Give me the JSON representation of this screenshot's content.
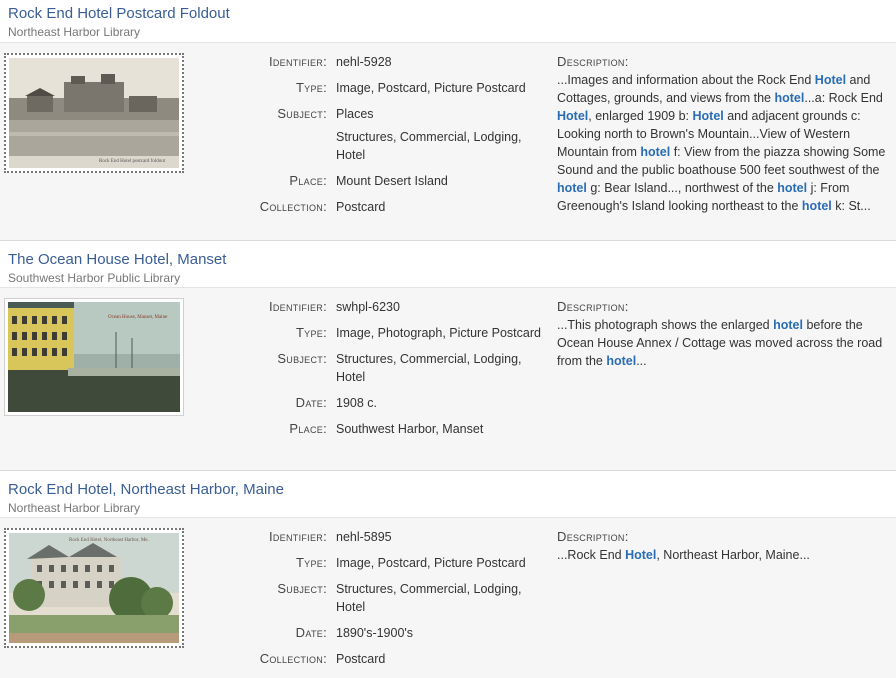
{
  "results": [
    {
      "title": "Rock End Hotel Postcard Foldout",
      "institution": "Northeast Harbor Library",
      "thumbnail_caption": "Rock End Hotel postcard foldout",
      "fields": [
        {
          "label": "Identifier:",
          "values": [
            "nehl-5928"
          ]
        },
        {
          "label": "Type:",
          "values": [
            "Image, Postcard, Picture Postcard"
          ]
        },
        {
          "label": "Subject:",
          "values": [
            "Places",
            "Structures, Commercial, Lodging, Hotel"
          ]
        },
        {
          "label": "Place:",
          "values": [
            "Mount Desert Island"
          ]
        },
        {
          "label": "Collection:",
          "values": [
            "Postcard"
          ]
        }
      ],
      "description_label": "Description:",
      "description": [
        {
          "t": "...Images and information about the Rock End ",
          "hl": false
        },
        {
          "t": "Hotel",
          "hl": true
        },
        {
          "t": " and Cottages, grounds, and views from the ",
          "hl": false
        },
        {
          "t": "hotel",
          "hl": true
        },
        {
          "t": "...a: Rock End ",
          "hl": false
        },
        {
          "t": "Hotel",
          "hl": true
        },
        {
          "t": ", enlarged 1909 b: ",
          "hl": false
        },
        {
          "t": "Hotel",
          "hl": true
        },
        {
          "t": " and adjacent grounds c: Looking north to Brown's Mountain...View of Western Mountain from ",
          "hl": false
        },
        {
          "t": "hotel",
          "hl": true
        },
        {
          "t": " f: View from the piazza showing Some Sound and the public boathouse 500 feet southwest of the ",
          "hl": false
        },
        {
          "t": "hotel",
          "hl": true
        },
        {
          "t": " g: Bear Island..., northwest of the ",
          "hl": false
        },
        {
          "t": "hotel",
          "hl": true
        },
        {
          "t": " j: From Greenough's Island looking northeast to the ",
          "hl": false
        },
        {
          "t": "hotel",
          "hl": true
        },
        {
          "t": " k: St...",
          "hl": false
        }
      ]
    },
    {
      "title": "The Ocean House Hotel, Manset",
      "institution": "Southwest Harbor Public Library",
      "thumbnail_caption": "Ocean House, Manset, Maine",
      "fields": [
        {
          "label": "Identifier:",
          "values": [
            "swhpl-6230"
          ]
        },
        {
          "label": "Type:",
          "values": [
            "Image, Photograph, Picture Postcard"
          ]
        },
        {
          "label": "Subject:",
          "values": [
            "Structures, Commercial, Lodging, Hotel"
          ]
        },
        {
          "label": "Date:",
          "values": [
            "1908 c."
          ]
        },
        {
          "label": "Place:",
          "values": [
            "Southwest Harbor, Manset"
          ]
        }
      ],
      "description_label": "Description:",
      "description": [
        {
          "t": "...This photograph shows the enlarged ",
          "hl": false
        },
        {
          "t": "hotel",
          "hl": true
        },
        {
          "t": " before the Ocean House Annex / Cottage was moved across the road from the ",
          "hl": false
        },
        {
          "t": "hotel",
          "hl": true
        },
        {
          "t": "...",
          "hl": false
        }
      ]
    },
    {
      "title": "Rock End Hotel, Northeast Harbor, Maine",
      "institution": "Northeast Harbor Library",
      "thumbnail_caption": "Rock End Hotel, Northeast Harbor, Me.",
      "fields": [
        {
          "label": "Identifier:",
          "values": [
            "nehl-5895"
          ]
        },
        {
          "label": "Type:",
          "values": [
            "Image, Postcard, Picture Postcard"
          ]
        },
        {
          "label": "Subject:",
          "values": [
            "Structures, Commercial, Lodging, Hotel"
          ]
        },
        {
          "label": "Date:",
          "values": [
            "1890's-1900's"
          ]
        },
        {
          "label": "Collection:",
          "values": [
            "Postcard"
          ]
        }
      ],
      "description_label": "Description:",
      "description": [
        {
          "t": "...Rock End ",
          "hl": false
        },
        {
          "t": "Hotel",
          "hl": true
        },
        {
          "t": ", Northeast Harbor, Maine...",
          "hl": false
        }
      ]
    }
  ],
  "colors": {
    "title_link": "#3a5d96",
    "highlight": "#2a6db5",
    "row_background": "#f6f6f6"
  }
}
